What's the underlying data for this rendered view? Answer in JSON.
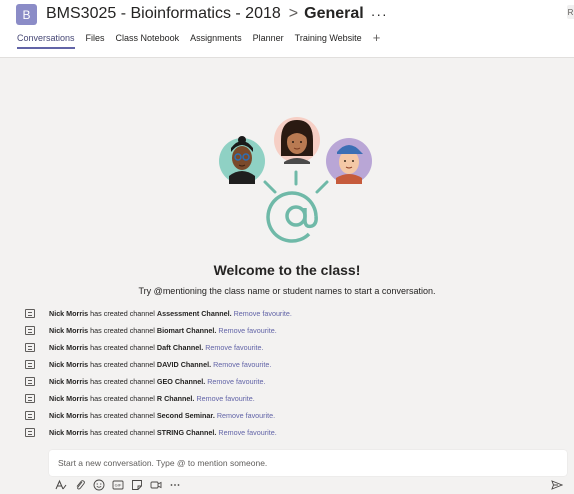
{
  "header": {
    "team_initial": "B",
    "team_name": "BMS3025 - Bioinformatics - 2018",
    "separator": ">",
    "channel_name": "General",
    "more_label": "···",
    "edge_label": "R"
  },
  "tabs": [
    {
      "label": "Conversations",
      "active": true
    },
    {
      "label": "Files"
    },
    {
      "label": "Class Notebook"
    },
    {
      "label": "Assignments"
    },
    {
      "label": "Planner"
    },
    {
      "label": "Training Website"
    }
  ],
  "tab_add_label": "+",
  "welcome": {
    "title": "Welcome to the class!",
    "hint": "Try @mentioning the class name or student names to start a conversation."
  },
  "feed": [
    {
      "user": "Nick Morris",
      "text": "has created channel",
      "channel": "Assessment Channel.",
      "link": "Remove favourite."
    },
    {
      "user": "Nick Morris",
      "text": "has created channel",
      "channel": "Biomart Channel.",
      "link": "Remove favourite."
    },
    {
      "user": "Nick Morris",
      "text": "has created channel",
      "channel": "Daft Channel.",
      "link": "Remove favourite."
    },
    {
      "user": "Nick Morris",
      "text": "has created channel",
      "channel": "DAVID Channel.",
      "link": "Remove favourite."
    },
    {
      "user": "Nick Morris",
      "text": "has created channel",
      "channel": "GEO Channel.",
      "link": "Remove favourite."
    },
    {
      "user": "Nick Morris",
      "text": "has created channel",
      "channel": "R Channel.",
      "link": "Remove favourite."
    },
    {
      "user": "Nick Morris",
      "text": "has created channel",
      "channel": "Second Seminar.",
      "link": "Remove favourite."
    },
    {
      "user": "Nick Morris",
      "text": "has created channel",
      "channel": "STRING Channel.",
      "link": "Remove favourite."
    }
  ],
  "compose": {
    "placeholder": "Start a new conversation. Type @ to mention someone."
  },
  "toolbar_icons": [
    "format-icon",
    "attach-icon",
    "emoji-icon",
    "gif-icon",
    "sticker-icon",
    "meet-now-icon",
    "more-options-icon"
  ],
  "colors": {
    "accent": "#6264a7",
    "team_avatar": "#8b8cc7",
    "illustration_teal": "#6fb9a8"
  }
}
